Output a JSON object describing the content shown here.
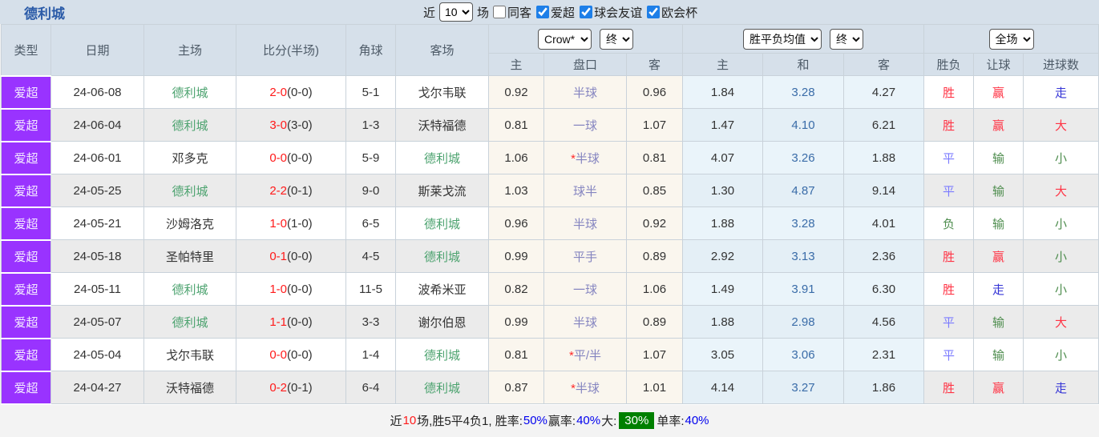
{
  "colors": {
    "accent_purple": "#9933ff",
    "header_bg": "#d6e0ea",
    "team_green": "#4ba26e",
    "score_red": "#ff1a1a",
    "handicap_lavender": "#8585c0",
    "avg_draw_blue": "#3a6ca8",
    "result_red": "#ff3344",
    "result_blue": "#3434d6",
    "result_periwinkle": "#7b7bff",
    "result_green": "#4e8d4e",
    "footer_badge_green": "#008000",
    "footer_blue": "#0000ee"
  },
  "header": {
    "team_title": "德利城",
    "filter": {
      "recent_label": "近",
      "recent_value": "10",
      "games_label": "场",
      "checkboxes": [
        {
          "label": "同客",
          "checked": false
        },
        {
          "label": "爱超",
          "checked": true
        },
        {
          "label": "球会友谊",
          "checked": true
        },
        {
          "label": "欧会杯",
          "checked": true
        }
      ]
    }
  },
  "table": {
    "columns": [
      "类型",
      "日期",
      "主场",
      "比分(半场)",
      "角球",
      "客场"
    ],
    "dropdowns": {
      "bookmaker": "Crow*",
      "bookmaker_state": "终",
      "avg": "胜平负均值",
      "avg_state": "终",
      "scope": "全场"
    },
    "subheaders": {
      "odds": [
        "主",
        "盘口",
        "客"
      ],
      "avg": [
        "主",
        "和",
        "客"
      ],
      "result": [
        "胜负",
        "让球",
        "进球数"
      ]
    },
    "rows": [
      {
        "league": "爱超",
        "date": "24-06-08",
        "home": "德利城",
        "home_green": true,
        "ft": "2-0",
        "ht": "(0-0)",
        "corner": "5-1",
        "away": "戈尔韦联",
        "away_green": false,
        "odds_home": "0.92",
        "star": false,
        "handicap": "半球",
        "odds_away": "0.96",
        "avg_home": "1.84",
        "avg_draw": "3.28",
        "avg_away": "4.27",
        "result": {
          "t": "胜",
          "c": "red"
        },
        "hresult": {
          "t": "赢",
          "c": "red"
        },
        "goals": {
          "t": "走",
          "c": "blue"
        }
      },
      {
        "league": "爱超",
        "date": "24-06-04",
        "home": "德利城",
        "home_green": true,
        "ft": "3-0",
        "ht": "(3-0)",
        "corner": "1-3",
        "away": "沃特福德",
        "away_green": false,
        "odds_home": "0.81",
        "star": false,
        "handicap": "一球",
        "odds_away": "1.07",
        "avg_home": "1.47",
        "avg_draw": "4.10",
        "avg_away": "6.21",
        "result": {
          "t": "胜",
          "c": "red"
        },
        "hresult": {
          "t": "赢",
          "c": "red"
        },
        "goals": {
          "t": "大",
          "c": "red"
        }
      },
      {
        "league": "爱超",
        "date": "24-06-01",
        "home": "邓多克",
        "home_green": false,
        "ft": "0-0",
        "ht": "(0-0)",
        "corner": "5-9",
        "away": "德利城",
        "away_green": true,
        "odds_home": "1.06",
        "star": true,
        "handicap": "半球",
        "odds_away": "0.81",
        "avg_home": "4.07",
        "avg_draw": "3.26",
        "avg_away": "1.88",
        "result": {
          "t": "平",
          "c": "peri"
        },
        "hresult": {
          "t": "输",
          "c": "green"
        },
        "goals": {
          "t": "小",
          "c": "green"
        }
      },
      {
        "league": "爱超",
        "date": "24-05-25",
        "home": "德利城",
        "home_green": true,
        "ft": "2-2",
        "ht": "(0-1)",
        "corner": "9-0",
        "away": "斯莱戈流",
        "away_green": false,
        "odds_home": "1.03",
        "star": false,
        "handicap": "球半",
        "odds_away": "0.85",
        "avg_home": "1.30",
        "avg_draw": "4.87",
        "avg_away": "9.14",
        "result": {
          "t": "平",
          "c": "peri"
        },
        "hresult": {
          "t": "输",
          "c": "green"
        },
        "goals": {
          "t": "大",
          "c": "red"
        }
      },
      {
        "league": "爱超",
        "date": "24-05-21",
        "home": "沙姆洛克",
        "home_green": false,
        "ft": "1-0",
        "ht": "(1-0)",
        "corner": "6-5",
        "away": "德利城",
        "away_green": true,
        "odds_home": "0.96",
        "star": false,
        "handicap": "半球",
        "odds_away": "0.92",
        "avg_home": "1.88",
        "avg_draw": "3.28",
        "avg_away": "4.01",
        "result": {
          "t": "负",
          "c": "green"
        },
        "hresult": {
          "t": "输",
          "c": "green"
        },
        "goals": {
          "t": "小",
          "c": "green"
        }
      },
      {
        "league": "爱超",
        "date": "24-05-18",
        "home": "圣帕特里",
        "home_green": false,
        "ft": "0-1",
        "ht": "(0-0)",
        "corner": "4-5",
        "away": "德利城",
        "away_green": true,
        "odds_home": "0.99",
        "star": false,
        "handicap": "平手",
        "odds_away": "0.89",
        "avg_home": "2.92",
        "avg_draw": "3.13",
        "avg_away": "2.36",
        "result": {
          "t": "胜",
          "c": "red"
        },
        "hresult": {
          "t": "赢",
          "c": "red"
        },
        "goals": {
          "t": "小",
          "c": "green"
        }
      },
      {
        "league": "爱超",
        "date": "24-05-11",
        "home": "德利城",
        "home_green": true,
        "ft": "1-0",
        "ht": "(0-0)",
        "corner": "11-5",
        "away": "波希米亚",
        "away_green": false,
        "odds_home": "0.82",
        "star": false,
        "handicap": "一球",
        "odds_away": "1.06",
        "avg_home": "1.49",
        "avg_draw": "3.91",
        "avg_away": "6.30",
        "result": {
          "t": "胜",
          "c": "red"
        },
        "hresult": {
          "t": "走",
          "c": "blue"
        },
        "goals": {
          "t": "小",
          "c": "green"
        }
      },
      {
        "league": "爱超",
        "date": "24-05-07",
        "home": "德利城",
        "home_green": true,
        "ft": "1-1",
        "ht": "(0-0)",
        "corner": "3-3",
        "away": "谢尔伯恩",
        "away_green": false,
        "odds_home": "0.99",
        "star": false,
        "handicap": "半球",
        "odds_away": "0.89",
        "avg_home": "1.88",
        "avg_draw": "2.98",
        "avg_away": "4.56",
        "result": {
          "t": "平",
          "c": "peri"
        },
        "hresult": {
          "t": "输",
          "c": "green"
        },
        "goals": {
          "t": "大",
          "c": "red"
        }
      },
      {
        "league": "爱超",
        "date": "24-05-04",
        "home": "戈尔韦联",
        "home_green": false,
        "ft": "0-0",
        "ht": "(0-0)",
        "corner": "1-4",
        "away": "德利城",
        "away_green": true,
        "odds_home": "0.81",
        "star": true,
        "handicap": "平/半",
        "odds_away": "1.07",
        "avg_home": "3.05",
        "avg_draw": "3.06",
        "avg_away": "2.31",
        "result": {
          "t": "平",
          "c": "peri"
        },
        "hresult": {
          "t": "输",
          "c": "green"
        },
        "goals": {
          "t": "小",
          "c": "green"
        }
      },
      {
        "league": "爱超",
        "date": "24-04-27",
        "home": "沃特福德",
        "home_green": false,
        "ft": "0-2",
        "ht": "(0-1)",
        "corner": "6-4",
        "away": "德利城",
        "away_green": true,
        "odds_home": "0.87",
        "star": true,
        "handicap": "半球",
        "odds_away": "1.01",
        "avg_home": "4.14",
        "avg_draw": "3.27",
        "avg_away": "1.86",
        "result": {
          "t": "胜",
          "c": "red"
        },
        "hresult": {
          "t": "赢",
          "c": "red"
        },
        "goals": {
          "t": "走",
          "c": "blue"
        }
      }
    ]
  },
  "footer": {
    "segments": [
      {
        "text": "近",
        "color": "black"
      },
      {
        "text": "10",
        "color": "red"
      },
      {
        "text": "场,胜5平4负1, 胜率:",
        "color": "black"
      },
      {
        "text": "50%",
        "color": "blue"
      },
      {
        "text": " 赢率:",
        "color": "black"
      },
      {
        "text": "40%",
        "color": "blue"
      },
      {
        "text": " 大:",
        "color": "black"
      },
      {
        "text": "30%",
        "color": "greenbadge"
      },
      {
        "text": " 单率:",
        "color": "black"
      },
      {
        "text": "40%",
        "color": "blue"
      }
    ]
  }
}
